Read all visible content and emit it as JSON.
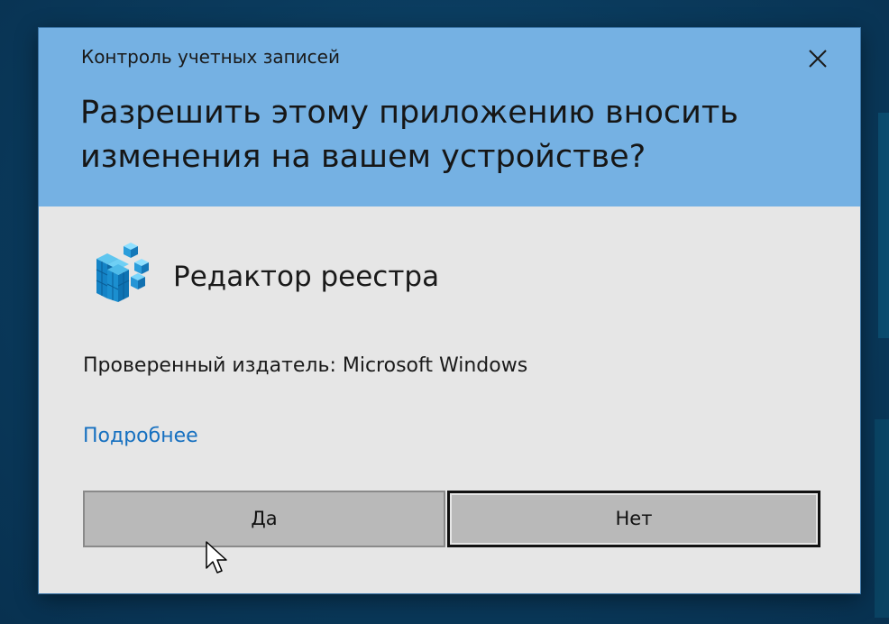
{
  "dialog": {
    "title": "Контроль учетных записей",
    "question": "Разрешить этому приложению вносить изменения на вашем устройстве?",
    "app_name": "Редактор реестра",
    "publisher": "Проверенный издатель: Microsoft Windows",
    "more_link": "Подробнее",
    "yes_label": "Да",
    "no_label": "Нет",
    "icons": {
      "close": "close-icon",
      "app": "registry-editor-icon",
      "cursor": "mouse-pointer-icon"
    }
  },
  "colors": {
    "header_bg": "#75b1e3",
    "body_bg": "#e6e6e6",
    "button_bg": "#b9b9b9",
    "link": "#1670c0",
    "desktop_bg": "#0b3f63"
  }
}
